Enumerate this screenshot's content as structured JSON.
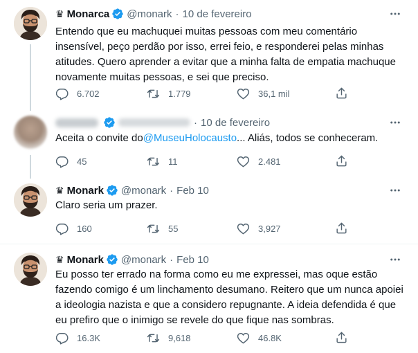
{
  "tweets": [
    {
      "crown": "♛",
      "name": "Monarca",
      "handle": "@monark",
      "dot": "·",
      "date": "10 de fevereiro",
      "text": "Entendo que eu machuquei muitas pessoas com meu comentário insensível, peço perdão por isso, errei feio, e responderei pelas minhas atitudes. Quero aprender a evitar que a minha falta de empatia machuque novamente muitas pessoas, e sei que preciso.",
      "replies": "6.702",
      "retweets": "1.779",
      "likes": "36,1 mil"
    },
    {
      "dot": "·",
      "date": "10 de fevereiro",
      "text_before": "Aceita o convite do",
      "mention": "@MuseuHolocausto",
      "text_after": "... Aliás, todos se conheceram.",
      "replies": "45",
      "retweets": "11",
      "likes": "2.481"
    },
    {
      "crown": "♛",
      "name": "Monark",
      "handle": "@monark",
      "dot": "·",
      "date": "Feb 10",
      "text": "Claro seria um prazer.",
      "replies": "160",
      "retweets": "55",
      "likes": "3,927"
    },
    {
      "crown": "♛",
      "name": "Monark",
      "handle": "@monark",
      "dot": "·",
      "date": "Feb 10",
      "text": "Eu posso ter errado na forma como eu me expressei, mas oque estão fazendo comigo é um linchamento desumano. Reitero que um nunca apoiei a ideologia nazista e que a considero repugnante. A ideia defendida é que eu prefiro que o inimigo se revele do que fique nas sombras.",
      "replies": "16.3K",
      "retweets": "9,618",
      "likes": "46.8K"
    }
  ],
  "colors": {
    "verified": "#1d9bf0",
    "link": "#1d9bf0",
    "muted": "#536471",
    "text": "#0f1419",
    "thread_line": "#cfd9de"
  },
  "icons": [
    "crown-icon",
    "verified-badge-icon",
    "more-options-icon",
    "reply-icon",
    "retweet-icon",
    "like-icon",
    "share-icon"
  ]
}
